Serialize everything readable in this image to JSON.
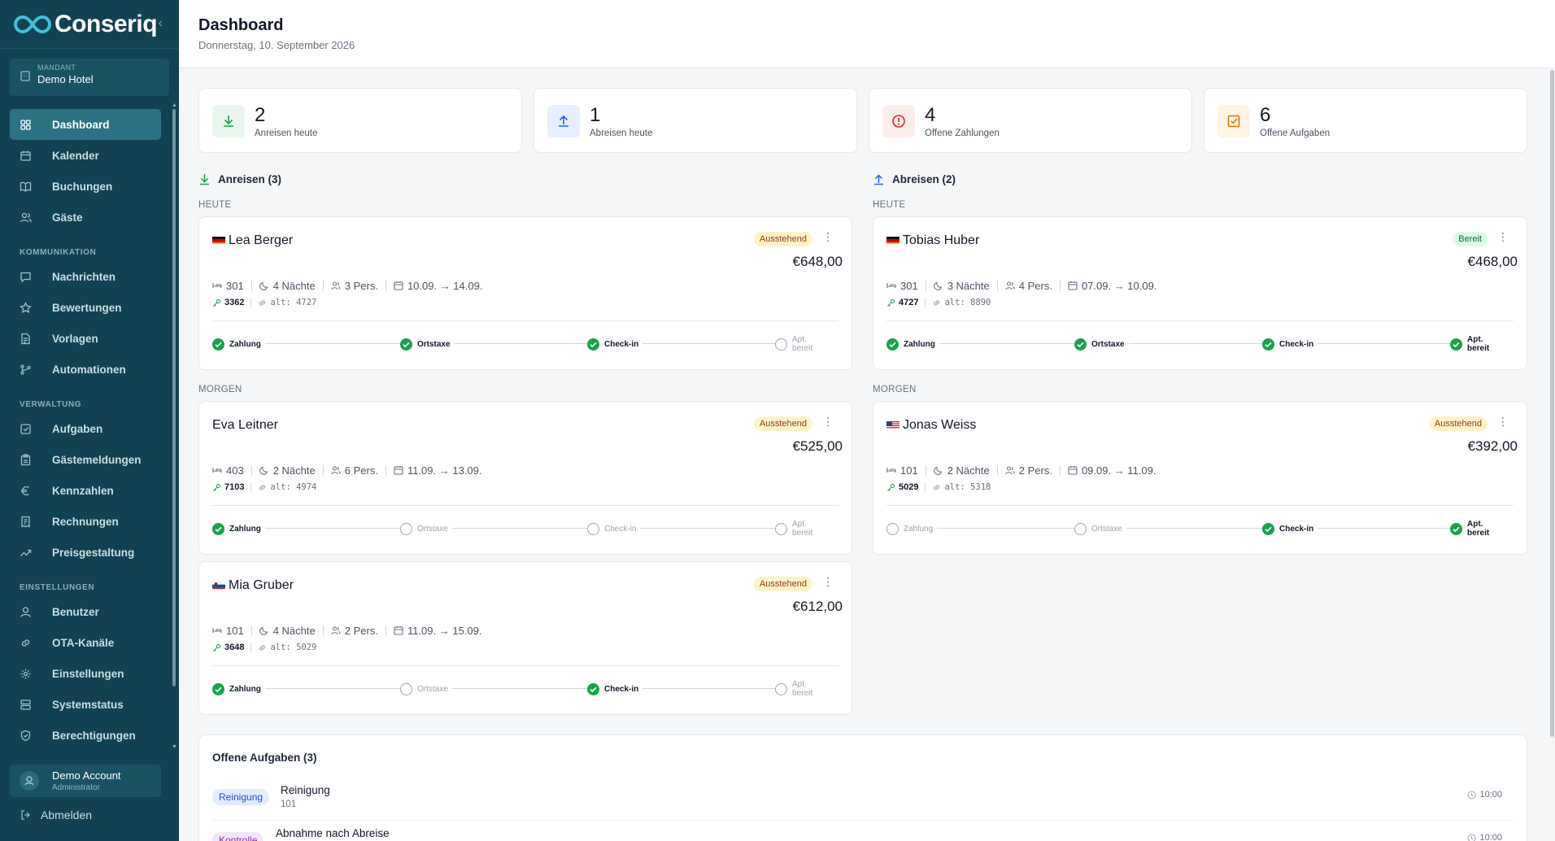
{
  "brand": {
    "name": "Conseriq"
  },
  "tenant": {
    "label": "MANDANT",
    "value": "Demo Hotel"
  },
  "nav": {
    "items_main": [
      {
        "label": "Dashboard",
        "icon": "grid-icon",
        "active": true
      },
      {
        "label": "Kalender",
        "icon": "calendar-icon"
      },
      {
        "label": "Buchungen",
        "icon": "book-icon"
      },
      {
        "label": "Gäste",
        "icon": "users-icon"
      }
    ],
    "sec_comm": "KOMMUNIKATION",
    "items_comm": [
      {
        "label": "Nachrichten",
        "icon": "message-icon"
      },
      {
        "label": "Bewertungen",
        "icon": "star-icon"
      },
      {
        "label": "Vorlagen",
        "icon": "document-icon"
      },
      {
        "label": "Automationen",
        "icon": "workflow-icon"
      }
    ],
    "sec_admin": "VERWALTUNG",
    "items_admin": [
      {
        "label": "Aufgaben",
        "icon": "checkbox-icon"
      },
      {
        "label": "Gästemeldungen",
        "icon": "clipboard-icon"
      },
      {
        "label": "Kennzahlen",
        "icon": "euro-icon"
      },
      {
        "label": "Rechnungen",
        "icon": "invoice-icon"
      },
      {
        "label": "Preisgestaltung",
        "icon": "trend-icon"
      }
    ],
    "sec_settings": "EINSTELLUNGEN",
    "items_settings": [
      {
        "label": "Benutzer",
        "icon": "user-icon"
      },
      {
        "label": "OTA-Kanäle",
        "icon": "link-icon"
      },
      {
        "label": "Einstellungen",
        "icon": "gear-icon"
      },
      {
        "label": "Systemstatus",
        "icon": "server-icon"
      },
      {
        "label": "Berechtigungen",
        "icon": "shield-icon"
      }
    ]
  },
  "account": {
    "name": "Demo Account",
    "role": "Administrator",
    "logout": "Abmelden"
  },
  "header": {
    "title": "Dashboard",
    "date": "Donnerstag, 10. September 2026"
  },
  "stats": [
    {
      "value": "2",
      "label": "Anreisen heute",
      "icon": "arrow-down-icon",
      "color": "#16a34a",
      "bg": "#e8f7ee"
    },
    {
      "value": "1",
      "label": "Abreisen heute",
      "icon": "arrow-up-icon",
      "color": "#2563eb",
      "bg": "#e6efff"
    },
    {
      "value": "4",
      "label": "Offene Zahlungen",
      "icon": "alert-icon",
      "color": "#dc2626",
      "bg": "#fdecec"
    },
    {
      "value": "6",
      "label": "Offene Aufgaben",
      "icon": "task-icon",
      "color": "#d97706",
      "bg": "#fdf4e3"
    }
  ],
  "arrivals": {
    "title": "Anreisen (3)",
    "today": "HEUTE",
    "tomorrow": "MORGEN"
  },
  "departures": {
    "title": "Abreisen (2)",
    "today": "HEUTE",
    "tomorrow": "MORGEN"
  },
  "step_labels": [
    "Zahlung",
    "Ortstaxe",
    "Check-in",
    "Apt. bereit"
  ],
  "cards": {
    "lea": {
      "name": "Lea Berger",
      "flag": "de",
      "badge": "Ausstehend",
      "price": "€648,00",
      "room": "301",
      "nights": "4 Nächte",
      "persons": "3 Pers.",
      "dates": "10.09. → 14.09.",
      "code": "3362",
      "alt": "alt: 4727",
      "steps": [
        true,
        true,
        true,
        false
      ]
    },
    "eva": {
      "name": "Eva Leitner",
      "flag": "",
      "badge": "Ausstehend",
      "price": "€525,00",
      "room": "403",
      "nights": "2 Nächte",
      "persons": "6 Pers.",
      "dates": "11.09. → 13.09.",
      "code": "7103",
      "alt": "alt: 4974",
      "steps": [
        true,
        false,
        false,
        false
      ]
    },
    "mia": {
      "name": "Mia Gruber",
      "flag": "si",
      "badge": "Ausstehend",
      "price": "€612,00",
      "room": "101",
      "nights": "4 Nächte",
      "persons": "2 Pers.",
      "dates": "11.09. → 15.09.",
      "code": "3648",
      "alt": "alt: 5029",
      "steps": [
        true,
        false,
        true,
        false
      ]
    },
    "tobias": {
      "name": "Tobias Huber",
      "flag": "de",
      "badge": "Bereit",
      "price": "€468,00",
      "room": "301",
      "nights": "3 Nächte",
      "persons": "4 Pers.",
      "dates": "07.09. → 10.09.",
      "code": "4727",
      "alt": "alt: 8890",
      "steps": [
        true,
        true,
        true,
        true
      ]
    },
    "jonas": {
      "name": "Jonas Weiss",
      "flag": "us",
      "badge": "Ausstehend",
      "price": "€392,00",
      "room": "101",
      "nights": "2 Nächte",
      "persons": "2 Pers.",
      "dates": "09.09. → 11.09.",
      "code": "5029",
      "alt": "alt: 5318",
      "steps": [
        false,
        false,
        true,
        true
      ]
    }
  },
  "tasks": {
    "title": "Offene Aufgaben (3)",
    "items": [
      {
        "badge": "Reinigung",
        "title": "Reinigung",
        "sub": "101",
        "time": "10:00"
      },
      {
        "badge": "Kontrolle",
        "title": "Abnahme nach Abreise",
        "sub": "",
        "time": "10:00"
      }
    ]
  }
}
